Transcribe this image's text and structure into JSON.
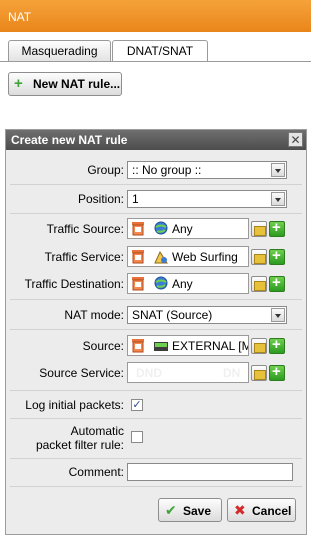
{
  "header": {
    "title": "NAT"
  },
  "tabs": [
    {
      "label": "Masquerading"
    },
    {
      "label": "DNAT/SNAT"
    }
  ],
  "toolbar": {
    "new_rule_label": "New NAT rule..."
  },
  "dialog": {
    "title": "Create new NAT rule",
    "close_glyph": "✕",
    "group": {
      "label": "Group:",
      "value": ":: No group ::"
    },
    "position": {
      "label": "Position:",
      "value": "1"
    },
    "traffic_source": {
      "label": "Traffic Source:",
      "value": "Any"
    },
    "traffic_service": {
      "label": "Traffic Service:",
      "value": "Web Surfing"
    },
    "traffic_destination": {
      "label": "Traffic Destination:",
      "value": "Any"
    },
    "nat_mode": {
      "label": "NAT mode:",
      "value": "SNAT (Source)"
    },
    "source": {
      "label": "Source:",
      "value": "EXTERNAL [M"
    },
    "source_service": {
      "label": "Source Service:",
      "placeholder_left": "DND",
      "placeholder_right": "DN"
    },
    "log_initial": {
      "label": "Log initial packets:",
      "checked": true
    },
    "auto_filter": {
      "label_line1": "Automatic",
      "label_line2": "packet filter rule:",
      "checked": false
    },
    "comment": {
      "label": "Comment:",
      "value": ""
    },
    "save_label": "Save",
    "cancel_label": "Cancel"
  },
  "icons": {
    "new_rule": "plus-icon",
    "trash": "trash-icon",
    "globe": "globe-network-icon",
    "service": "service-icon",
    "interface": "network-interface-icon",
    "folder": "folder-icon",
    "add": "add-icon",
    "save": "checkmark-icon",
    "cancel": "cross-icon"
  },
  "colors": {
    "header": "#e9861b",
    "dialog_header": "#5a5a5a",
    "accent_green": "#3fa33a",
    "cancel_red": "#d22a2a"
  }
}
